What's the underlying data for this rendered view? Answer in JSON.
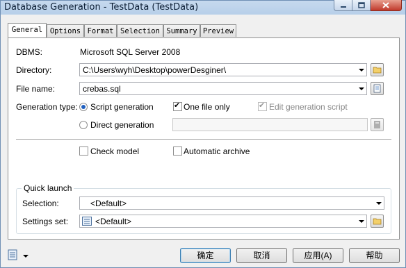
{
  "window": {
    "title": "Database Generation - TestData (TestData)"
  },
  "tabs": [
    {
      "label": "General",
      "active": true
    },
    {
      "label": "Options"
    },
    {
      "label": "Format"
    },
    {
      "label": "Selection"
    },
    {
      "label": "Summary"
    },
    {
      "label": "Preview"
    }
  ],
  "general": {
    "dbms_label": "DBMS:",
    "dbms_value": "Microsoft SQL Server 2008",
    "directory_label": "Directory:",
    "directory_value": "C:\\Users\\wyh\\Desktop\\powerDesginer\\",
    "filename_label": "File name:",
    "filename_value": "crebas.sql",
    "gentype_label": "Generation type:",
    "script_generation": {
      "label": "Script generation",
      "selected": true
    },
    "direct_generation": {
      "label": "Direct generation",
      "selected": false
    },
    "one_file_only": {
      "label": "One file only",
      "checked": true
    },
    "edit_generation_script": {
      "label": "Edit generation script",
      "checked": true,
      "disabled": true
    },
    "direct_value": "",
    "check_model": {
      "label": "Check model",
      "checked": false
    },
    "automatic_archive": {
      "label": "Automatic archive",
      "checked": false
    }
  },
  "quick_launch": {
    "title": "Quick launch",
    "selection_label": "Selection:",
    "selection_value": "<Default>",
    "settings_label": "Settings set:",
    "settings_value": "<Default>"
  },
  "buttons": {
    "ok": "确定",
    "cancel": "取消",
    "apply": "应用(A)",
    "help": "帮助"
  },
  "colors": {
    "titlebar": "#b7cfe9",
    "close": "#c0392b",
    "radio_accent": "#1f5fbf"
  }
}
